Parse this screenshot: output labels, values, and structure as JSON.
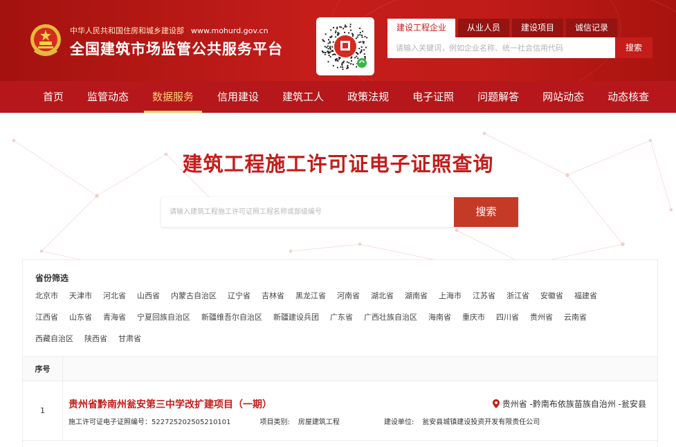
{
  "header": {
    "org_name": "中华人民共和国住房和城乡建设部",
    "url": "www.mohurd.gov.cn",
    "site_title": "全国建筑市场监管公共服务平台",
    "search_tabs": [
      {
        "label": "建设工程企业",
        "active": true
      },
      {
        "label": "从业人员",
        "active": false
      },
      {
        "label": "建设项目",
        "active": false
      },
      {
        "label": "诚信记录",
        "active": false
      }
    ],
    "search_placeholder": "请输入关键词，例如企业名称、统一社会信用代码",
    "search_button": "搜索"
  },
  "nav": {
    "items": [
      {
        "label": "首页",
        "active": false
      },
      {
        "label": "监管动态",
        "active": false
      },
      {
        "label": "数据服务",
        "active": true
      },
      {
        "label": "信用建设",
        "active": false
      },
      {
        "label": "建筑工人",
        "active": false
      },
      {
        "label": "政策法规",
        "active": false
      },
      {
        "label": "电子证照",
        "active": false
      },
      {
        "label": "问题解答",
        "active": false
      },
      {
        "label": "网站动态",
        "active": false
      },
      {
        "label": "动态核查",
        "active": false
      }
    ]
  },
  "main": {
    "title": "建筑工程施工许可证电子证照查询",
    "search_placeholder": "请输入建筑工程施工许可证照工程名称或部级编号",
    "search_button": "搜索"
  },
  "filter": {
    "title": "省份筛选",
    "rows": [
      [
        "北京市",
        "天津市",
        "河北省",
        "山西省",
        "内蒙古自治区",
        "辽宁省",
        "吉林省",
        "黑龙江省",
        "河南省",
        "湖北省",
        "湖南省",
        "上海市",
        "江苏省",
        "浙江省",
        "安徽省",
        "福建省"
      ],
      [
        "江西省",
        "山东省",
        "青海省",
        "宁夏回族自治区",
        "新疆维吾尔自治区",
        "新疆建设兵团",
        "广东省",
        "广西壮族自治区",
        "海南省",
        "重庆市",
        "四川省",
        "贵州省",
        "云南省"
      ],
      [
        "西藏自治区",
        "陕西省",
        "甘肃省"
      ]
    ]
  },
  "table": {
    "header_index": "序号",
    "rows": [
      {
        "index": "1",
        "name": "贵州省黔南州瓮安第三中学改扩建项目（一期）",
        "location": "贵州省 -黔南布依族苗族自治州 -瓮安县",
        "cert_label": "施工许可证电子证照编号：",
        "cert_no": "522725202505210101",
        "category_label": "项目类别:",
        "category": "房屋建筑工程",
        "builder_label": "建设单位:",
        "builder": "瓮安县城镇建设投资开发有限责任公司"
      }
    ]
  },
  "colors": {
    "brand_red": "#c41d1a",
    "nav_red": "#b5171a",
    "nav_active": "#ffd37a",
    "search_button": "#c53a26"
  },
  "icons": [
    "national-emblem-icon",
    "qr-code-icon",
    "location-pin-icon"
  ]
}
